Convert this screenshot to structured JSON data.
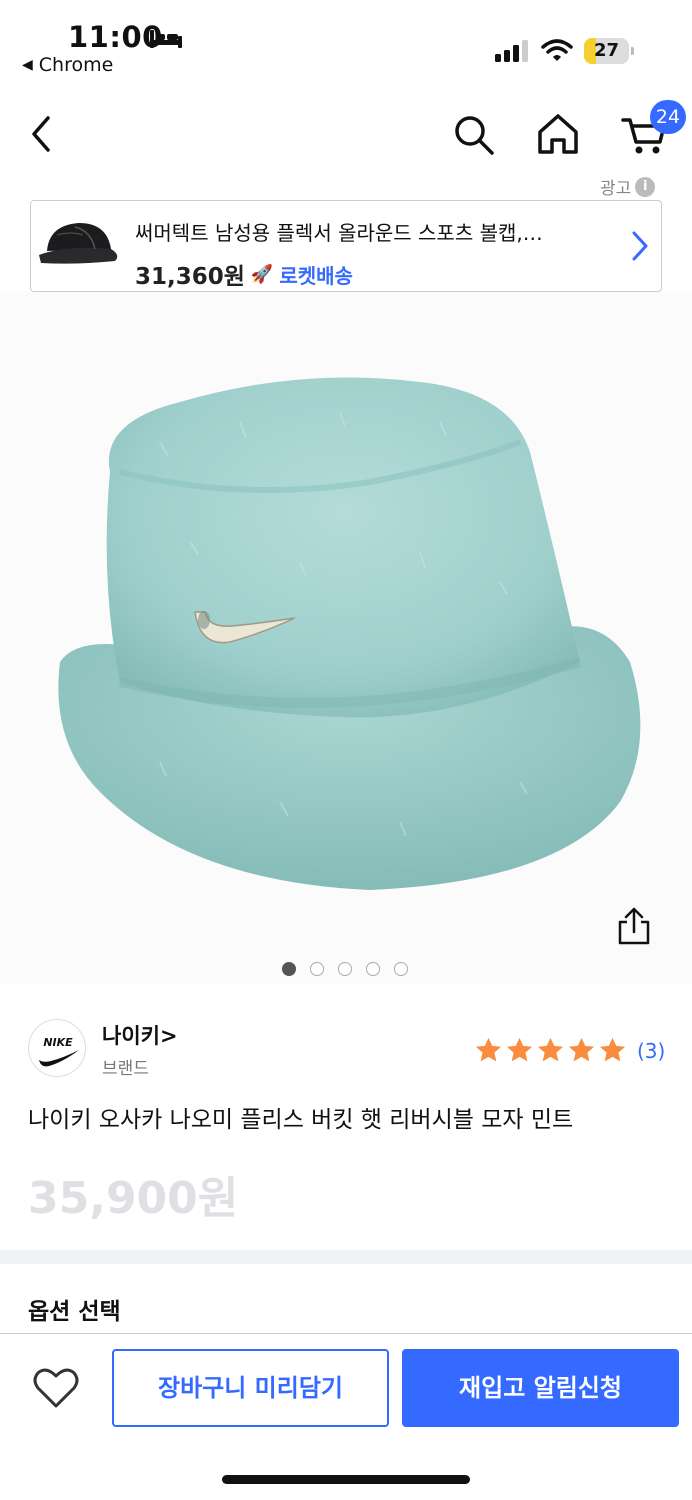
{
  "status_bar": {
    "time": "11:00",
    "back_app": "Chrome",
    "battery": "27",
    "battery_level": 0.27
  },
  "nav": {
    "cart_count": "24"
  },
  "ad": {
    "label": "광고",
    "title": "써머텍트 남성용 플렉서 올라운드 스포츠 볼캡,…",
    "price": "31,360원",
    "shipping": "로켓배송"
  },
  "gallery": {
    "image_count": 5,
    "active_index": 0
  },
  "brand": {
    "name": "나이키>",
    "subtitle": "브랜드",
    "logo_text": "NIKE"
  },
  "rating": {
    "stars": 5,
    "count": "(3)"
  },
  "product": {
    "title": "나이키 오사카 나오미 플리스 버킷 햇 리버시블 모자 민트",
    "price": "35,900원"
  },
  "options": {
    "title": "옵션 선택"
  },
  "bottom_bar": {
    "cart_button": "장바구니 미리담기",
    "restock_button": "재입고 알림신청"
  },
  "colors": {
    "accent": "#346aff",
    "star": "#f98c3d",
    "hat": "#9fcfcc"
  }
}
